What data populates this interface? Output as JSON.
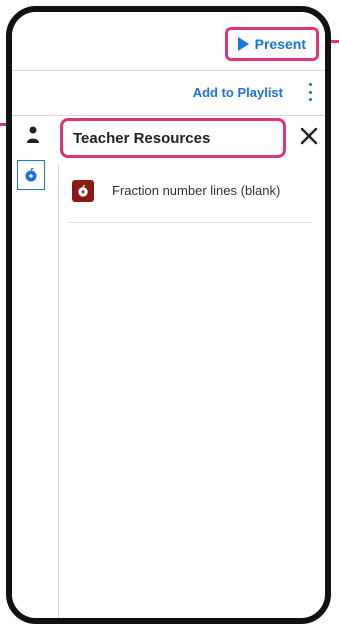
{
  "header": {
    "present_label": "Present"
  },
  "actions": {
    "add_to_playlist_label": "Add to Playlist"
  },
  "panel": {
    "title": "Teacher Resources",
    "items": [
      {
        "label": "Fraction number lines (blank)",
        "icon": "apple-icon"
      }
    ]
  },
  "colors": {
    "accent": "#1a73e8",
    "highlight": "#e0337a",
    "resource_icon_bg": "#8b1a14"
  }
}
